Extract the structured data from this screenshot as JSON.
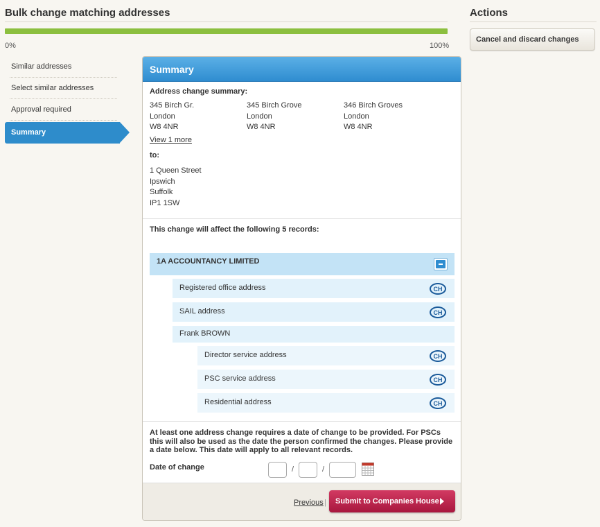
{
  "header": {
    "title": "Bulk change matching addresses",
    "progress_min": "0%",
    "progress_max": "100%",
    "progress_value": 1.0,
    "progress_color": "#8cbf3f"
  },
  "actions": {
    "title": "Actions",
    "cancel_label": "Cancel and discard changes"
  },
  "steps": [
    {
      "label": "Similar addresses",
      "active": false
    },
    {
      "label": "Select similar addresses",
      "active": false
    },
    {
      "label": "Approval required",
      "active": false
    },
    {
      "label": "Summary",
      "active": true
    }
  ],
  "panel": {
    "title": "Summary",
    "summary_label": "Address change summary:",
    "from_addresses": [
      {
        "line1": "345 Birch Gr.",
        "line2": "London",
        "line3": "W8 4NR"
      },
      {
        "line1": "345 Birch Grove",
        "line2": "London",
        "line3": "W8 4NR"
      },
      {
        "line1": "346 Birch Groves",
        "line2": "London",
        "line3": "W8 4NR"
      }
    ],
    "view_more": "View 1 more",
    "to_label": "to:",
    "to_address": {
      "line1": "1 Queen Street",
      "line2": "Ipswich",
      "line3": "Suffolk",
      "line4": "IP1 1SW"
    },
    "affect_text": "This change will affect the following 5 records:",
    "company": "1A ACCOUNTANCY LIMITED",
    "records": {
      "registered": "Registered office address",
      "sail": "SAIL address",
      "person": "Frank BROWN",
      "director": "Director service address",
      "psc": "PSC service address",
      "residential": "Residential address"
    },
    "note": "At least one address change requires a date of change to be provided. For PSCs this will also be used as the date the person confirmed the changes. Please provide a date below. This date will apply to all relevant records.",
    "date_label": "Date of change",
    "date_sep": "/",
    "previous_label": "Previous",
    "pipe": "|",
    "submit_label": "Submit to Companies House"
  },
  "colors": {
    "accent_blue": "#2e8ccb",
    "submit_red": "#b81f47"
  },
  "icons": {
    "ch_logo": "companies-house-logo-icon",
    "calendar": "calendar-icon",
    "collapse": "minus-icon"
  }
}
